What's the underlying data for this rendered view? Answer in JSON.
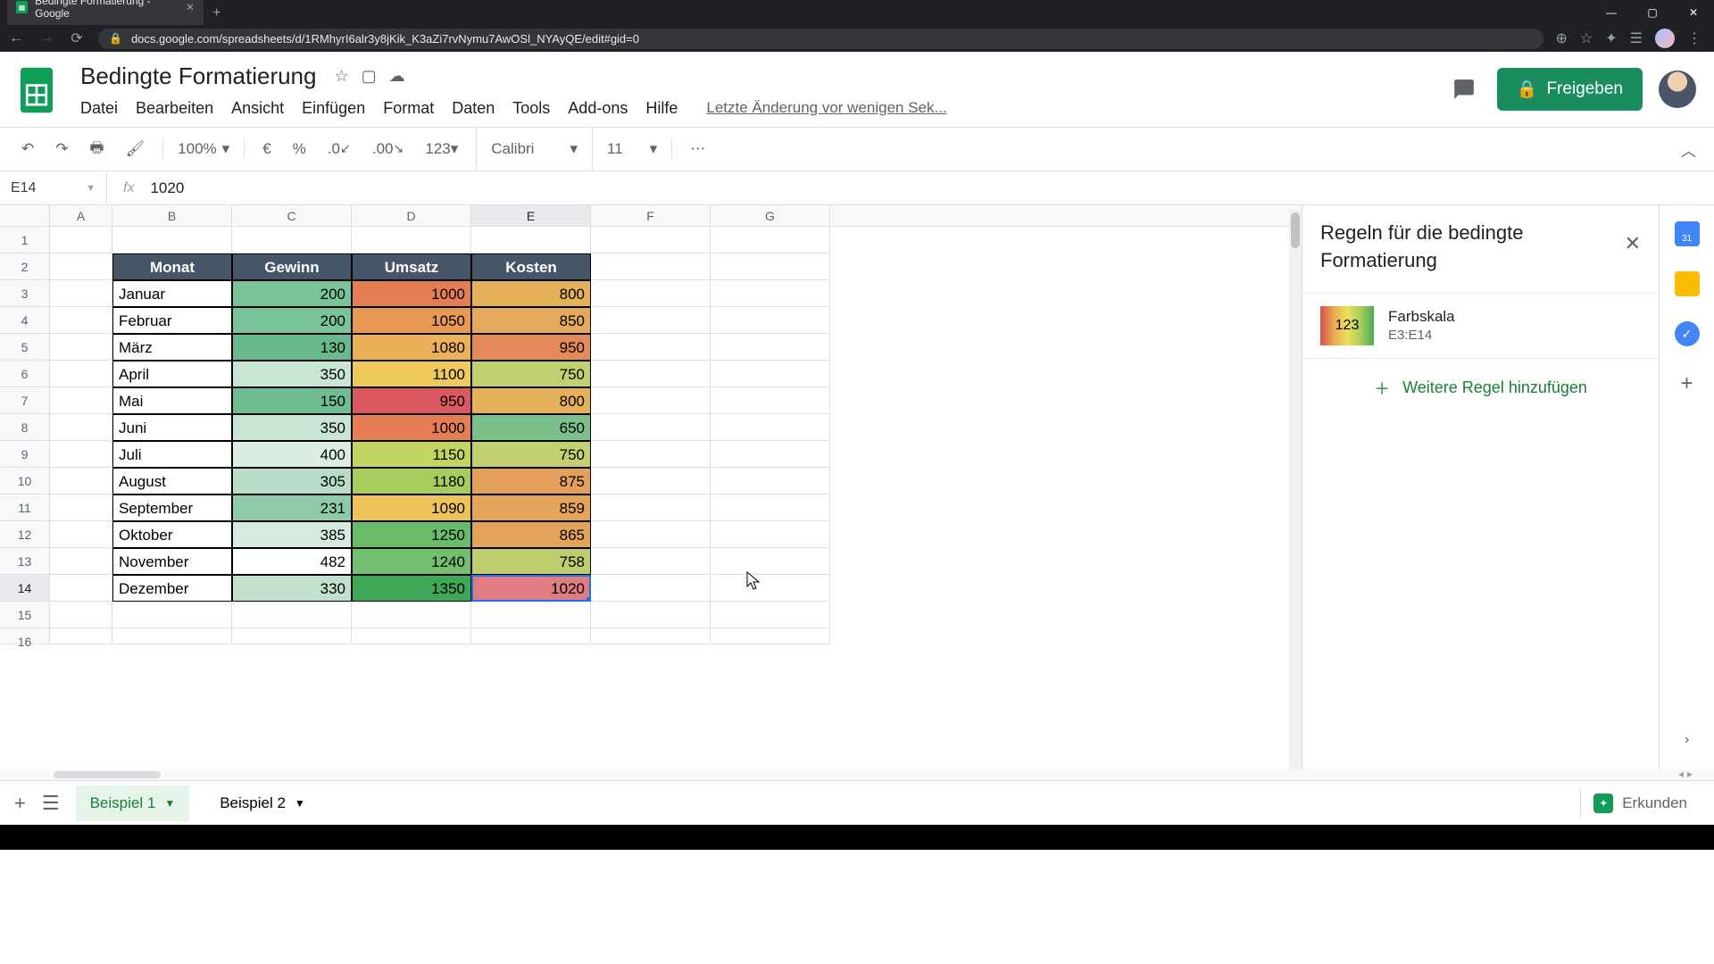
{
  "browser": {
    "tab_title": "Bedingte Formatierung - Google",
    "url": "docs.google.com/spreadsheets/d/1RMhyrI6alr3y8jKik_K3aZi7rvNymu7AwOSl_NYAyQE/edit#gid=0"
  },
  "doc": {
    "title": "Bedingte Formatierung",
    "menus": [
      "Datei",
      "Bearbeiten",
      "Ansicht",
      "Einfügen",
      "Format",
      "Daten",
      "Tools",
      "Add-ons",
      "Hilfe"
    ],
    "last_edit": "Letzte Änderung vor wenigen Sek...",
    "share_label": "Freigeben"
  },
  "toolbar": {
    "zoom": "100%",
    "currency": "€",
    "percent": "%",
    "dec_less": ".0",
    "dec_more": ".00",
    "numfmt": "123",
    "font": "Calibri",
    "fontsize": "11"
  },
  "formula": {
    "name_box": "E14",
    "value": "1020"
  },
  "columns": [
    "A",
    "B",
    "C",
    "D",
    "E",
    "F",
    "G"
  ],
  "header_row": [
    "Monat",
    "Gewinn",
    "Umsatz",
    "Kosten"
  ],
  "rows": [
    {
      "m": "Januar",
      "g": "200",
      "u": "1000",
      "k": "800",
      "cg": "#7bc49a",
      "cu": "#e57e54",
      "ck": "#e4b05a"
    },
    {
      "m": "Februar",
      "g": "200",
      "u": "1050",
      "k": "850",
      "cg": "#7bc49a",
      "cu": "#e89a54",
      "ck": "#e4a95a"
    },
    {
      "m": "März",
      "g": "130",
      "u": "1080",
      "k": "950",
      "cg": "#68b98b",
      "cu": "#ecb158",
      "ck": "#e48a5a"
    },
    {
      "m": "April",
      "g": "350",
      "u": "1100",
      "k": "750",
      "cg": "#c9e5d3",
      "cu": "#efc95c",
      "ck": "#c3d071"
    },
    {
      "m": "Mai",
      "g": "150",
      "u": "950",
      "k": "800",
      "cg": "#6fbc90",
      "cu": "#db5a61",
      "ck": "#e4b05a"
    },
    {
      "m": "Juni",
      "g": "350",
      "u": "1000",
      "k": "650",
      "cg": "#c9e5d3",
      "cu": "#e57e54",
      "ck": "#7bc08a"
    },
    {
      "m": "Juli",
      "g": "400",
      "u": "1150",
      "k": "750",
      "cg": "#dceee2",
      "cu": "#c3d460",
      "ck": "#c3d071"
    },
    {
      "m": "August",
      "g": "305",
      "u": "1180",
      "k": "875",
      "cg": "#b8dcc6",
      "cu": "#a6cd5e",
      "ck": "#e4a05a"
    },
    {
      "m": "September",
      "g": "231",
      "u": "1090",
      "k": "859",
      "cg": "#8ecba9",
      "cu": "#eec45a",
      "ck": "#e4a55a"
    },
    {
      "m": "Oktober",
      "g": "385",
      "u": "1250",
      "k": "865",
      "cg": "#d6ebdd",
      "cu": "#6abb6a",
      "ck": "#e4a25a"
    },
    {
      "m": "November",
      "g": "482",
      "u": "1240",
      "k": "758",
      "cg": "#ffffff",
      "cu": "#72bf6e",
      "ck": "#bdcd6f"
    },
    {
      "m": "Dezember",
      "g": "330",
      "u": "1350",
      "k": "1020",
      "cg": "#c1e1cd",
      "cu": "#3fa856",
      "ck": "#df7d82"
    }
  ],
  "cf_panel": {
    "title": "Regeln für die bedingte Formatierung",
    "rule_name": "Farbskala",
    "rule_range": "E3:E14",
    "rule_preview_text": "123",
    "add_rule": "Weitere Regel hinzufügen"
  },
  "sheets": {
    "tab1": "Beispiel 1",
    "tab2": "Beispiel 2",
    "explore": "Erkunden"
  },
  "chart_data": {
    "type": "table",
    "title": "Bedingte Formatierung",
    "columns": [
      "Monat",
      "Gewinn",
      "Umsatz",
      "Kosten"
    ],
    "data": [
      [
        "Januar",
        200,
        1000,
        800
      ],
      [
        "Februar",
        200,
        1050,
        850
      ],
      [
        "März",
        130,
        1080,
        950
      ],
      [
        "April",
        350,
        1100,
        750
      ],
      [
        "Mai",
        150,
        950,
        800
      ],
      [
        "Juni",
        350,
        1000,
        650
      ],
      [
        "Juli",
        400,
        1150,
        750
      ],
      [
        "August",
        305,
        1180,
        875
      ],
      [
        "September",
        231,
        1090,
        859
      ],
      [
        "Oktober",
        385,
        1250,
        865
      ],
      [
        "November",
        482,
        1240,
        758
      ],
      [
        "Dezember",
        330,
        1350,
        1020
      ]
    ]
  }
}
